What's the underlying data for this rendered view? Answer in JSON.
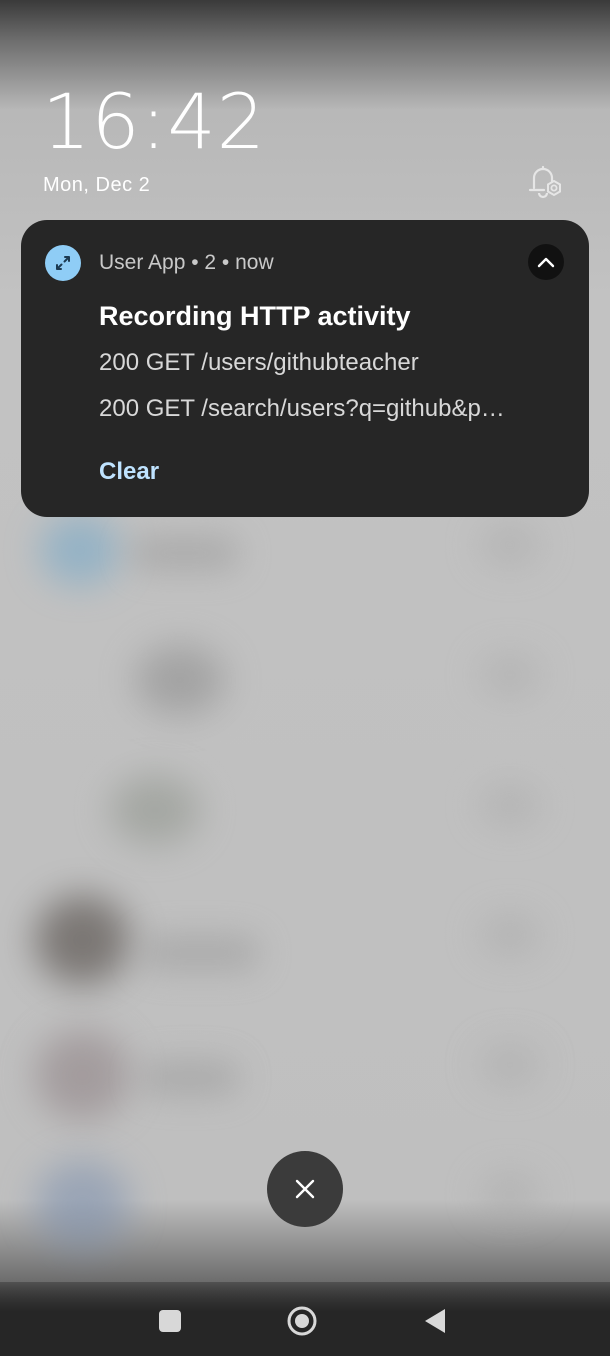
{
  "lockscreen": {
    "time": "16:42",
    "date": "Mon, Dec 2"
  },
  "notification": {
    "app_header": "User App • 2 • now",
    "title": "Recording HTTP activity",
    "lines": [
      "200 GET /users/githubteacher",
      "200 GET /search/users?q=github&p…"
    ],
    "action_label": "Clear",
    "app_icon": "compress-arrows-icon",
    "app_icon_color": "#8fcdf6",
    "card_color": "#262626",
    "action_color": "#bfe3ff"
  },
  "icons": {
    "bell_settings": "bell-settings-icon",
    "collapse": "chevron-up-icon",
    "dismiss_all": "close-icon",
    "nav_recents": "square-icon",
    "nav_home": "circle-icon",
    "nav_back": "triangle-back-icon"
  }
}
